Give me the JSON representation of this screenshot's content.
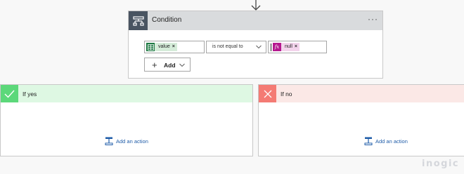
{
  "condition": {
    "title": "Condition",
    "more_label": "···",
    "left_operand": {
      "token_label": "value",
      "token_close": "×",
      "icon": "excel-icon"
    },
    "operator": {
      "value": "is not equal to"
    },
    "right_operand": {
      "token_label": "null",
      "token_close": "×",
      "token_icon_text": "fx",
      "icon": "expression-icon"
    },
    "add_button": {
      "plus": "+",
      "label": "Add"
    }
  },
  "branches": {
    "yes": {
      "title": "If yes",
      "icon": "check-icon",
      "add_action_label": "Add an action",
      "color": "#5cd87a",
      "header_bg": "#def8e3"
    },
    "no": {
      "title": "If no",
      "icon": "close-icon",
      "add_action_label": "Add an action",
      "color": "#f47b74",
      "header_bg": "#fbe8e6"
    }
  },
  "colors": {
    "accent": "#1f5ca8",
    "condition_icon_bg": "#495461",
    "token_green": "#1f7a44",
    "token_magenta": "#b5198f"
  },
  "watermark": {
    "text": "inogic"
  }
}
